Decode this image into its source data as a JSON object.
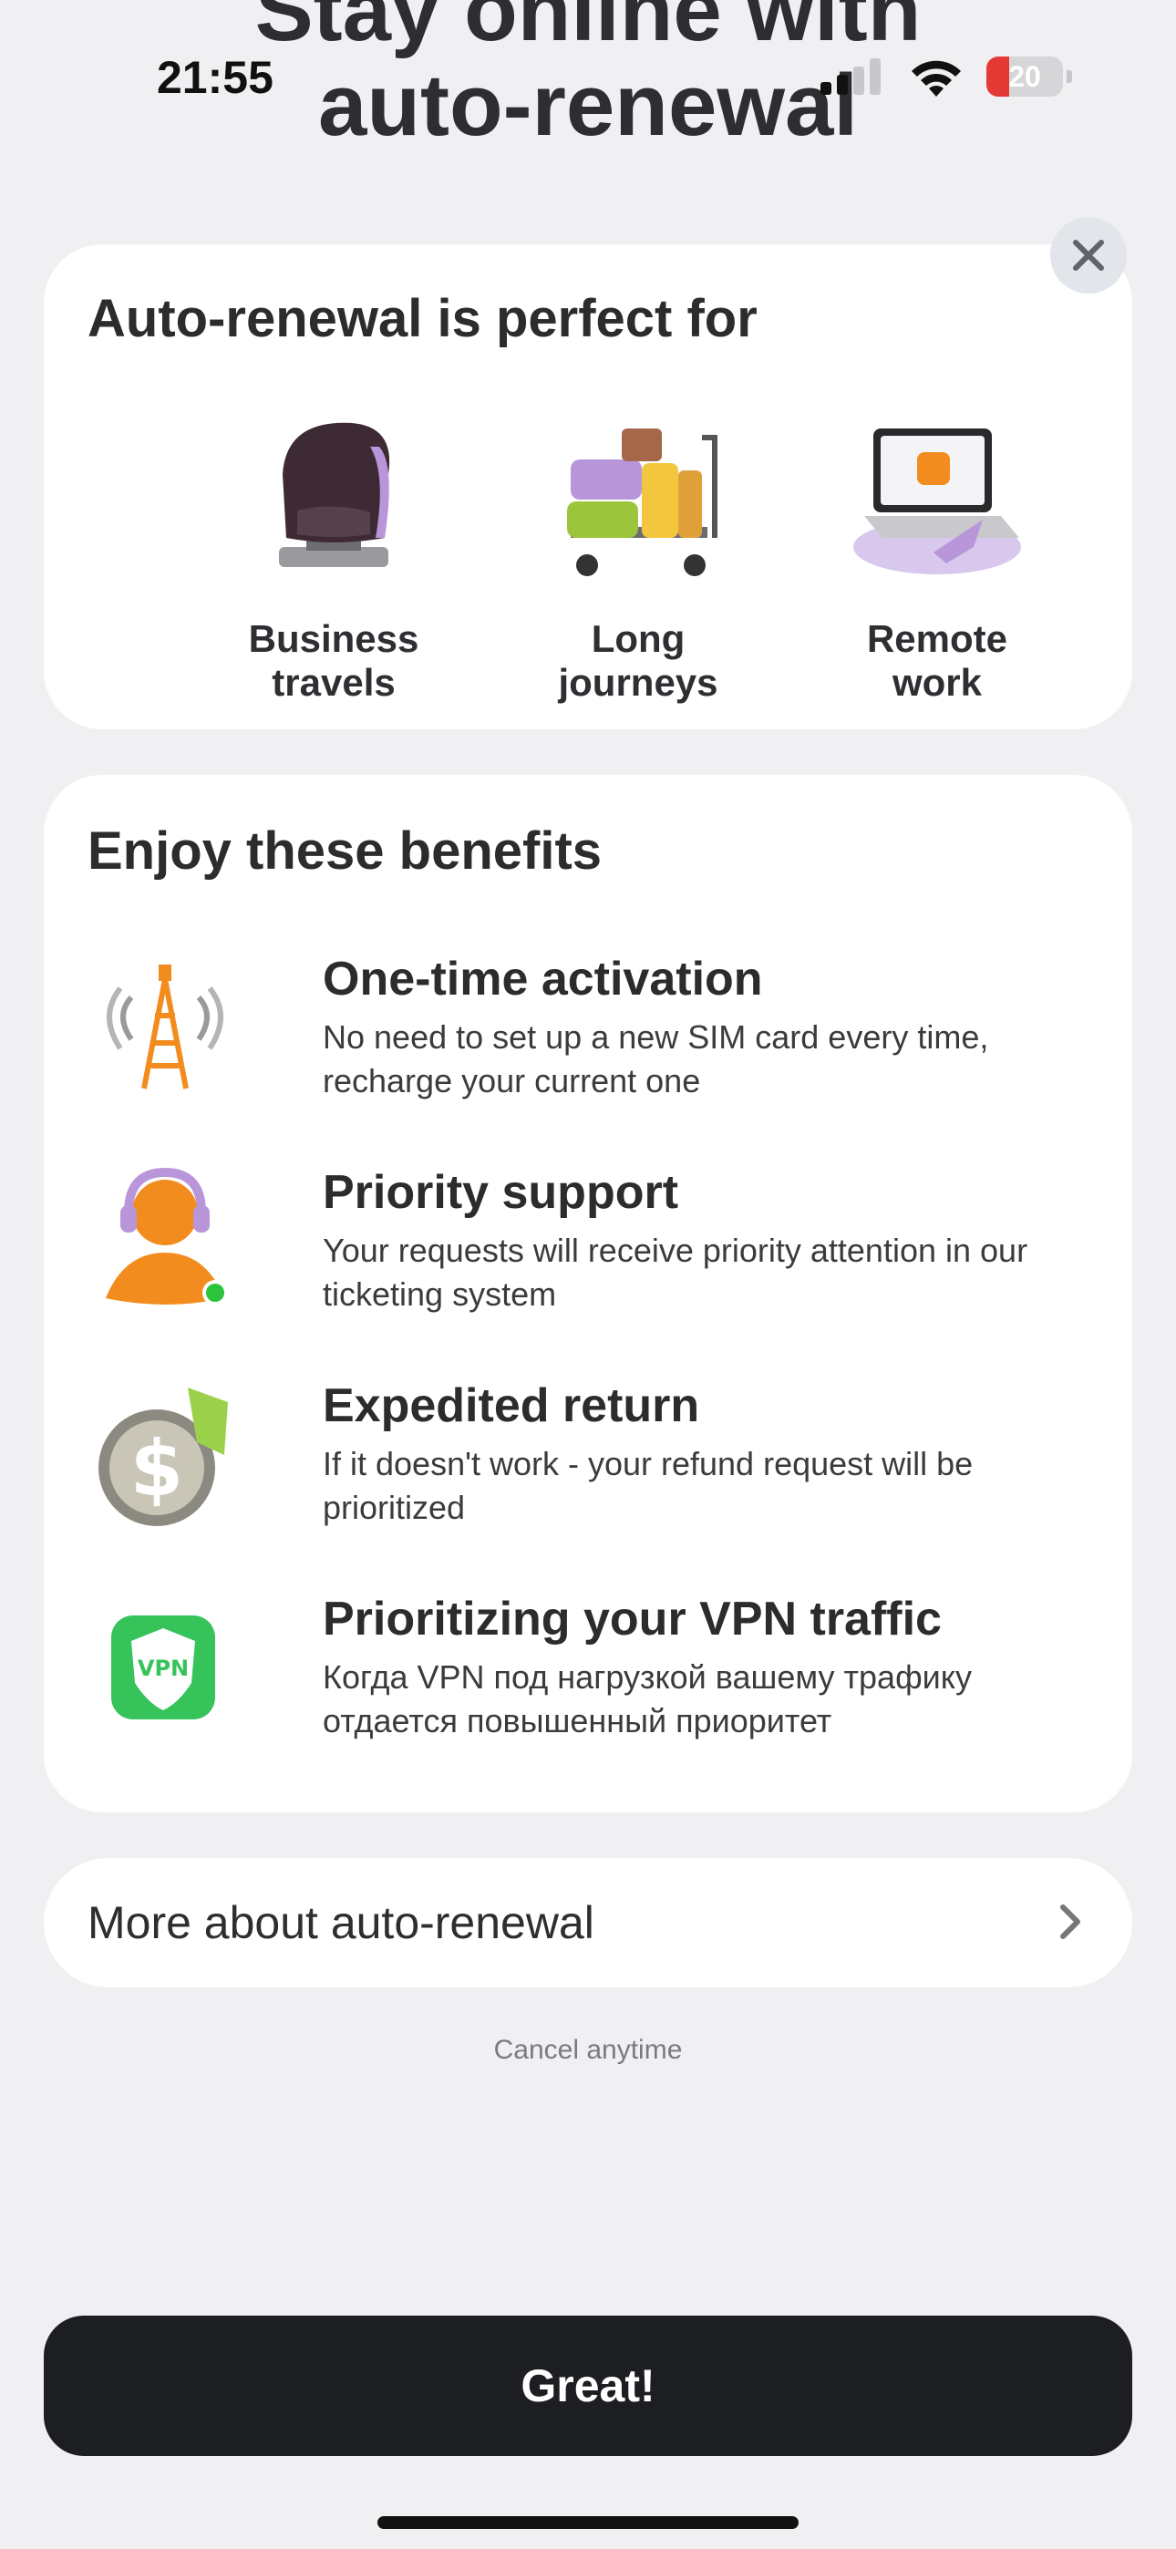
{
  "status_bar": {
    "time": "21:55",
    "battery_level": "20"
  },
  "hero": {
    "title_line1": "Stay online with",
    "title_line2": "auto-renewal"
  },
  "perfect_card": {
    "title": "Auto-renewal is perfect for",
    "items": [
      {
        "label": "Business\ntravels",
        "icon": "armchair-icon"
      },
      {
        "label": "Long\njourneys",
        "icon": "luggage-cart-icon"
      },
      {
        "label": "Remote\nwork",
        "icon": "laptop-icon"
      }
    ]
  },
  "benefits_card": {
    "title": "Enjoy these benefits",
    "items": [
      {
        "title": "One-time activation",
        "desc": "No need to set up a new SIM card every time, recharge your current one",
        "icon": "cell-tower-icon"
      },
      {
        "title": "Priority support",
        "desc": "Your requests will receive priority attention in our ticketing system",
        "icon": "support-agent-icon"
      },
      {
        "title": "Expedited return",
        "desc": "If it doesn't work - your refund request will be prioritized",
        "icon": "dollar-coin-icon"
      },
      {
        "title": "Prioritizing your VPN traffic",
        "desc": "Когда VPN под нагрузкой вашему трафику отдается повышенный приоритет",
        "icon": "vpn-shield-icon",
        "badge": "VPN"
      }
    ]
  },
  "more_row": {
    "label": "More about auto-renewal"
  },
  "cancel_note": "Cancel anytime",
  "cta": {
    "label": "Great!"
  },
  "colors": {
    "background": "#f0f0f3",
    "card": "#ffffff",
    "cta": "#1d1e21",
    "battery": "#e53935",
    "accent_purple": "#b896d9",
    "accent_orange": "#f28c1e",
    "vpn_green": "#35c35a"
  }
}
